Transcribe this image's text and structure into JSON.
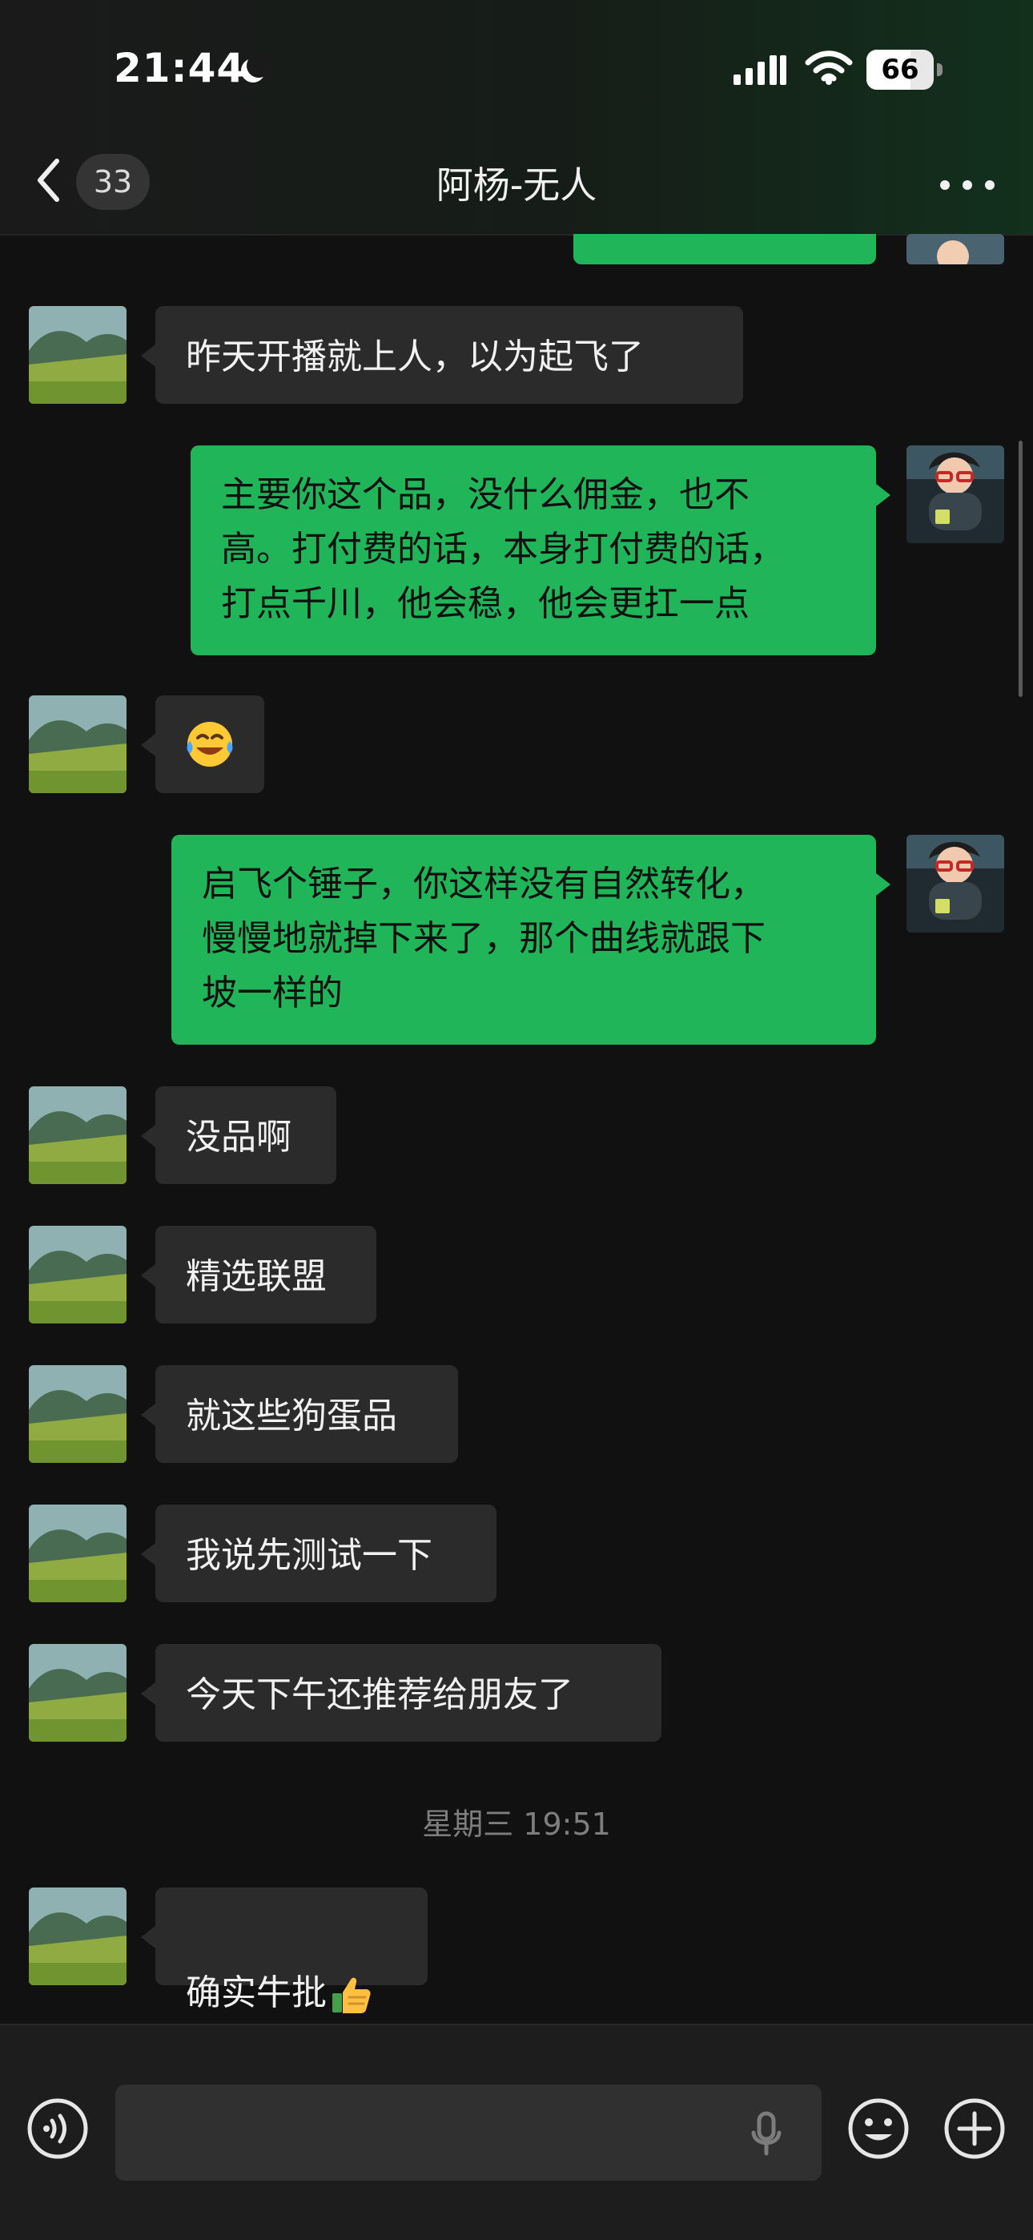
{
  "status_bar": {
    "time": "21:44",
    "battery_percent": "66",
    "moon_icon": "moon-icon",
    "signal_icon": "cellular-signal-icon",
    "wifi_icon": "wifi-icon"
  },
  "nav": {
    "back_icon": "back-arrow-icon",
    "unread_count": "33",
    "title": "阿杨-无人",
    "more_icon": "more-dots-icon"
  },
  "messages": [
    {
      "side": "left",
      "text": "昨天开播就上人，以为起飞了",
      "avatar": "landscape-avatar"
    },
    {
      "side": "right",
      "text": "主要你这个品，没什么佣金，也不\n高。打付费的话，本身打付费的话，\n打点千川，他会稳，他会更扛一点",
      "avatar": "cartoon-avatar"
    },
    {
      "side": "left",
      "text": "",
      "emoji_icon": "laughing-crying-emoji",
      "avatar": "landscape-avatar"
    },
    {
      "side": "right",
      "text": "启飞个锤子，你这样没有自然转化，\n慢慢地就掉下来了，那个曲线就跟下\n坡一样的",
      "avatar": "cartoon-avatar"
    },
    {
      "side": "left",
      "text": "没品啊",
      "avatar": "landscape-avatar"
    },
    {
      "side": "left",
      "text": "精选联盟",
      "avatar": "landscape-avatar"
    },
    {
      "side": "left",
      "text": "就这些狗蛋品",
      "avatar": "landscape-avatar"
    },
    {
      "side": "left",
      "text": "我说先测试一下",
      "avatar": "landscape-avatar"
    },
    {
      "side": "left",
      "text": "今天下午还推荐给朋友了",
      "avatar": "landscape-avatar"
    },
    {
      "side": "left",
      "text": "确实牛批",
      "emoji_icon": "thumbs-up-emoji",
      "avatar": "landscape-avatar"
    }
  ],
  "timestamp": "星期三 19:51",
  "input": {
    "placeholder": "",
    "voice_icon": "voice-icon",
    "mic_icon": "microphone-icon",
    "emoji_icon": "emoji-icon",
    "plus_icon": "plus-icon"
  },
  "colors": {
    "background": "#111111",
    "incoming_bubble": "#2b2b2b",
    "outgoing_bubble": "#21b55a",
    "text": "#f1f1f1",
    "secondary_text": "#7e7e7e"
  }
}
